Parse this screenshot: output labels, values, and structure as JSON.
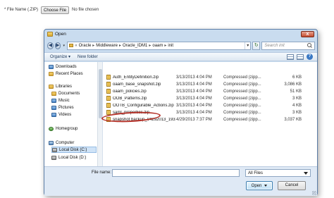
{
  "page": {
    "file_label": "* File Name (.ZIP)",
    "choose_button": "Choose File",
    "no_file_text": "No file chosen"
  },
  "dialog": {
    "title": "Open",
    "close_glyph": "x",
    "address": {
      "back_glyph": "◀",
      "forward_glyph": "▶",
      "drop_glyph": "▾",
      "chevron": "«",
      "crumbs": [
        "Oracle",
        "Middleware",
        "Oracle_IDM1",
        "oaam",
        "init"
      ],
      "separator": "▸",
      "refresh_glyph": "↻"
    },
    "search": {
      "placeholder": "Search init"
    },
    "toolbar": {
      "organize": "Organize ▾",
      "new_folder": "New folder",
      "help_glyph": "?"
    },
    "nav": [
      {
        "label": "Downloads",
        "icon": "downloads-icon"
      },
      {
        "label": "Recent Places",
        "icon": "recent-places-icon"
      },
      {
        "label": "Libraries",
        "icon": "libraries-icon"
      },
      {
        "label": "Documents",
        "icon": "documents-icon"
      },
      {
        "label": "Music",
        "icon": "music-icon"
      },
      {
        "label": "Pictures",
        "icon": "pictures-icon"
      },
      {
        "label": "Videos",
        "icon": "videos-icon"
      },
      {
        "label": "Homegroup",
        "icon": "homegroup-icon"
      },
      {
        "label": "Computer",
        "icon": "computer-icon"
      },
      {
        "label": "Local Disk (C:)",
        "icon": "disk-icon"
      },
      {
        "label": "Local Disk (D:)",
        "icon": "disk-icon"
      }
    ],
    "files": [
      {
        "name": "Auth_EntityDefinition.zip",
        "date": "3/13/2013 4:04 PM",
        "type": "Compressed (zipp...",
        "size": "6 KB"
      },
      {
        "name": "oaam_base_snapshot.zip",
        "date": "3/13/2013 4:04 PM",
        "type": "Compressed (zipp...",
        "size": "3,086 KB"
      },
      {
        "name": "oaam_policies.zip",
        "date": "3/13/2013 4:04 PM",
        "type": "Compressed (zipp...",
        "size": "51 KB"
      },
      {
        "name": "OOB_Patterns.zip",
        "date": "3/13/2013 4:04 PM",
        "type": "Compressed (zipp...",
        "size": "3 KB"
      },
      {
        "name": "OOTB_Configurable_Actions.zip",
        "date": "3/13/2013 4:04 PM",
        "type": "Compressed (zipp...",
        "size": "4 KB"
      },
      {
        "name": "saml_properties.zip",
        "date": "3/13/2013 4:04 PM",
        "type": "Compressed (zipp...",
        "size": "3 KB"
      },
      {
        "name": "snapshot backup_04292013_193706682.zip",
        "date": "4/29/2013 7:37 PM",
        "type": "Compressed (zipp...",
        "size": "3,037 KB"
      }
    ],
    "bottom": {
      "file_name_label": "File name:",
      "file_name_value": "",
      "filter": "All Files",
      "open": "Open",
      "cancel": "Cancel"
    }
  }
}
